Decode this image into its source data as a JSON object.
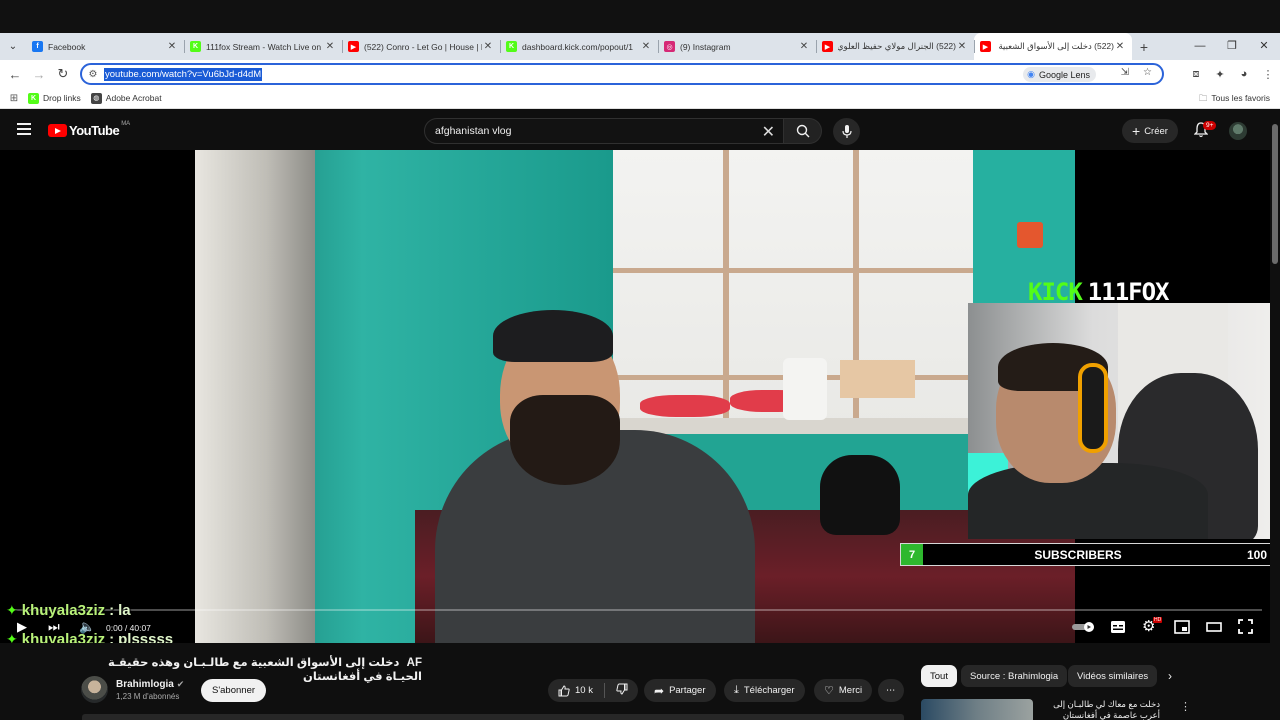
{
  "browser": {
    "tabs": [
      {
        "title": "Facebook",
        "favicon_color": "#1877f2",
        "favicon_letter": "f",
        "active": false
      },
      {
        "title": "111fox Stream - Watch Live on",
        "favicon_color": "#53fc18",
        "favicon_letter": "K",
        "active": false
      },
      {
        "title": "(522) Conro - Let Go | House | N",
        "favicon_color": "#ff0000",
        "favicon_letter": "▶",
        "active": false
      },
      {
        "title": "dashboard.kick.com/popout/1",
        "favicon_color": "#53fc18",
        "favicon_letter": "K",
        "active": false
      },
      {
        "title": "(9) Instagram",
        "favicon_color": "#d62976",
        "favicon_letter": "◎",
        "active": false
      },
      {
        "title": "(522) الجنرال مولاي حفيظ العلوي",
        "favicon_color": "#ff0000",
        "favicon_letter": "▶",
        "active": false
      },
      {
        "title": "(522) دخلت إلى الأسواق الشعبية",
        "favicon_color": "#ff0000",
        "favicon_letter": "▶",
        "active": true
      }
    ],
    "url": "youtube.com/watch?v=Vu6bJd-d4dM",
    "google_lens_label": "Google Lens",
    "bookmarks": [
      {
        "label": "Drop links",
        "icon_color": "#53fc18",
        "icon_letter": "K"
      },
      {
        "label": "Adobe Acrobat",
        "icon_color": "#444",
        "icon_letter": "◍"
      }
    ],
    "all_bookmarks_label": "Tous les favoris"
  },
  "youtube": {
    "logo_text": "YouTube",
    "country_code": "MA",
    "search_value": "afghanistan vlog",
    "create_label": "Créer",
    "notifications_badge": "9+",
    "player": {
      "kick_word": "KICK",
      "streamer_name": "111FOX",
      "subscribers_count": "7",
      "subscribers_label": "SUBSCRIBERS",
      "subscribers_goal": "100",
      "time_display": "0:00 / 40:07",
      "progress_fraction": 0.0,
      "hd_badge": "HD"
    },
    "chat": [
      {
        "user": "khuyala3ziz",
        "message": "la"
      },
      {
        "user": "khuyala3ziz",
        "message": "plsssss"
      }
    ],
    "video_title": "دخلت إلى الأسواق الشعبية مع طالـبـان وهذه حقيقـة الحيـاة في أفغانستان",
    "title_badge": "AF",
    "channel": {
      "name": "Brahimlogia",
      "subscribers": "1,23 M d'abonnés",
      "subscribe_label": "S'abonner"
    },
    "actions": {
      "likes": "10 k",
      "share_label": "Partager",
      "download_label": "Télécharger",
      "thanks_label": "Merci"
    },
    "chips": [
      "Tout",
      "Source : Brahimlogia",
      "Vidéos similaires"
    ],
    "recommended_title": "دخلت مع معاك لي طالبـان إلى أعرب عاصمة في أفغانستان وشوف كيفاش"
  }
}
